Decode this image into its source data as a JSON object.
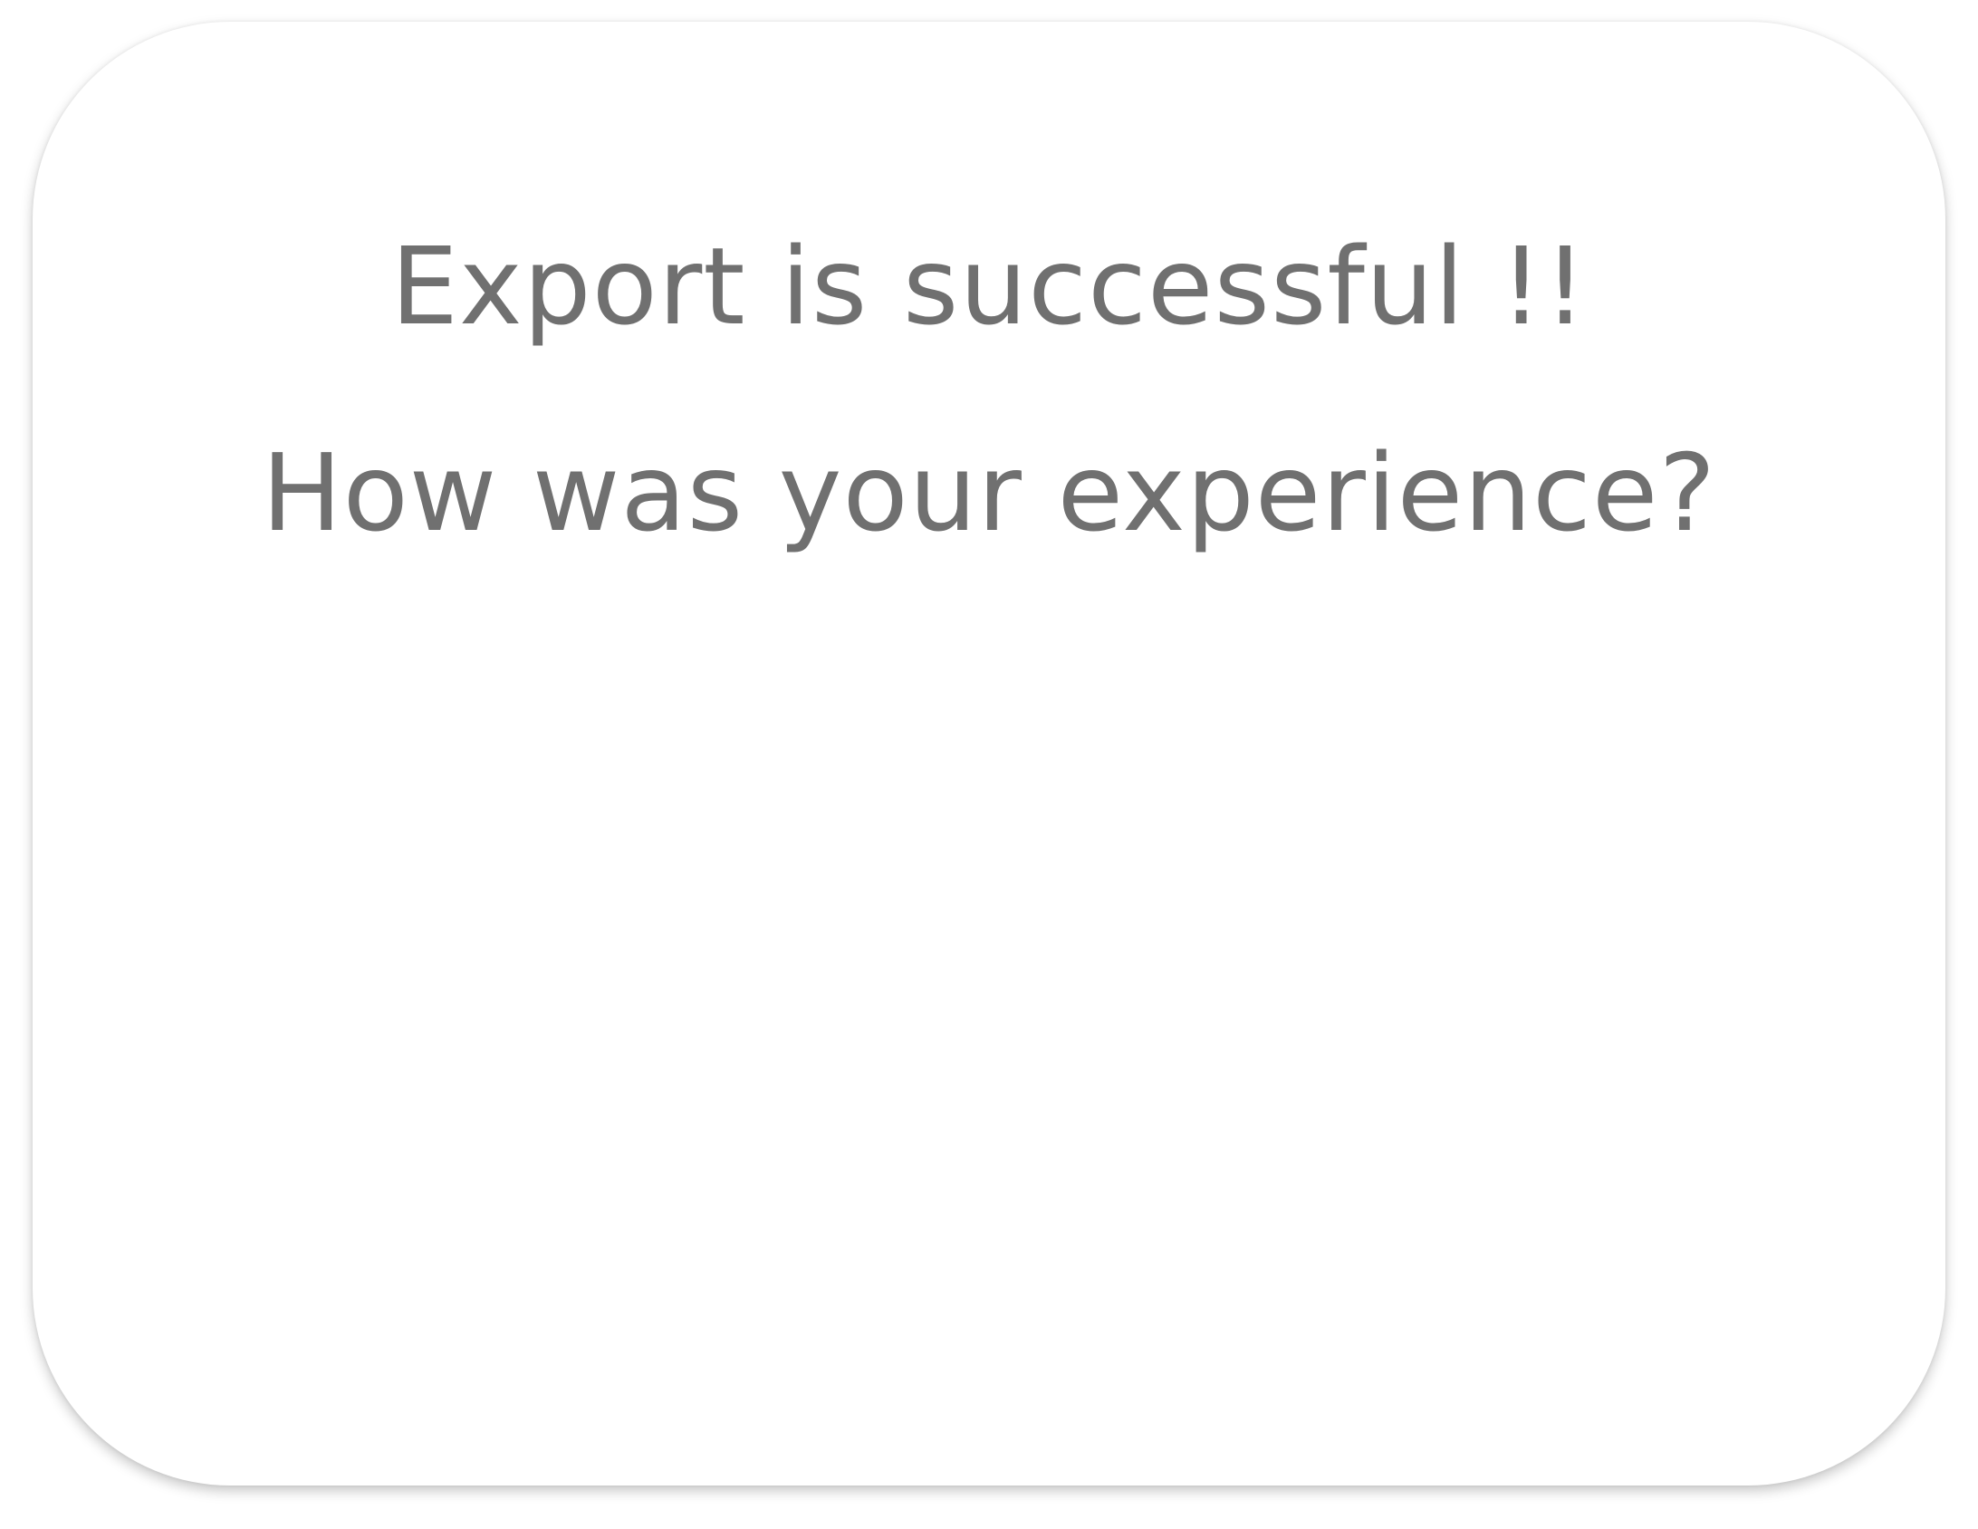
{
  "dialog": {
    "title": "Export is successful !!",
    "question": "How was your experience?"
  },
  "colors": {
    "text": "#707070",
    "background": "#ffffff"
  }
}
